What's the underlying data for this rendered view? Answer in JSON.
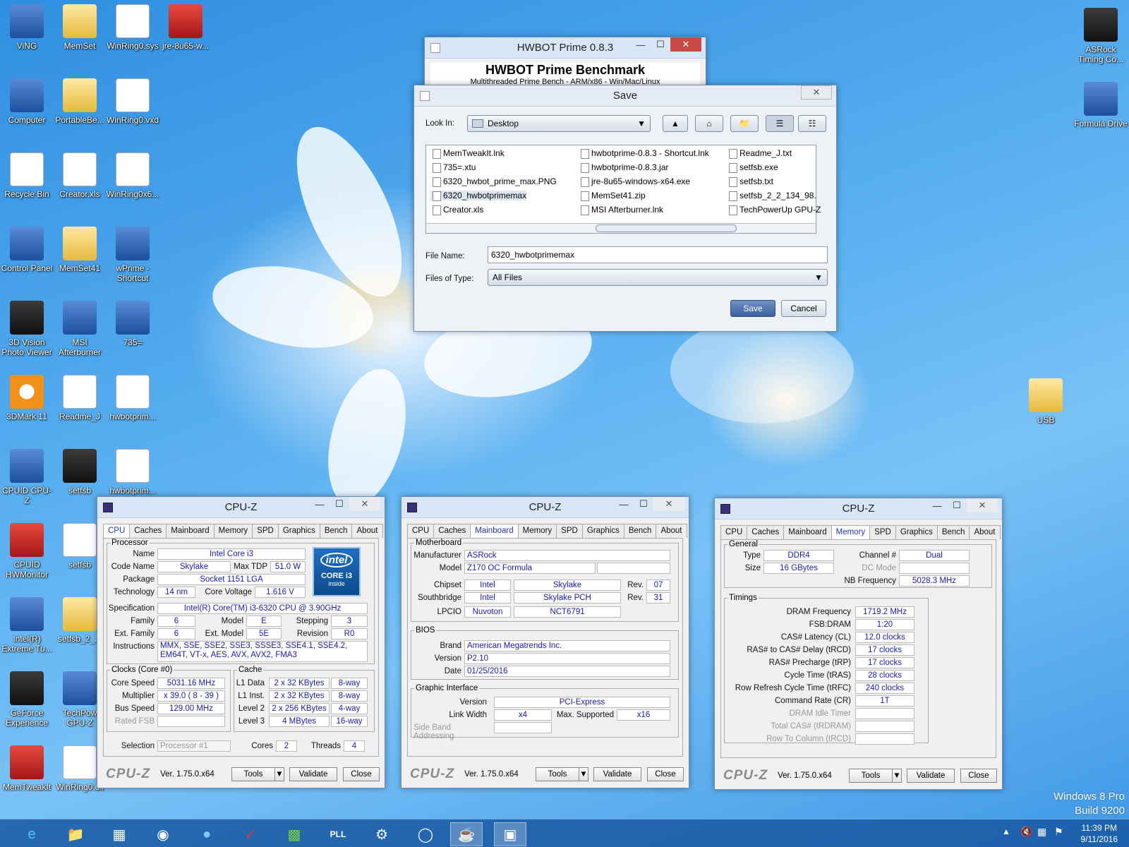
{
  "desktop_icons": [
    "ViNG",
    "MemSet",
    "WinRing0.sys",
    "jre-8u65-w...",
    "Computer",
    "PortableBe...",
    "WinRing0.vxd",
    "Recycle Bin",
    "Creator.xls",
    "WinRing0x6...",
    "Control Panel",
    "MemSet41",
    "wPrime - Shortcut",
    "3D Vision Photo Viewer",
    "MSI Afterburner",
    "735=",
    "3DMark 11",
    "Readme_J",
    "hwbotprim...",
    "CPUID CPU-Z",
    "setfsb",
    "hwbotprim...",
    "CPUID HWMonitor",
    "setfsb",
    "Intel(R) Extreme Tu...",
    "setfsb_2_...",
    "GeForce Experience",
    "TechPow GPU-Z",
    "MemTweakIt",
    "WinRing0.dll",
    "ASRock Timing Co...",
    "Formula Drive",
    "USB"
  ],
  "hwbot": {
    "title": "HWBOT Prime 0.8.3",
    "heading": "HWBOT Prime Benchmark",
    "sub": "Multithreaded Prime Bench - ARM/x86 - Win/Mac/Linux"
  },
  "save": {
    "title": "Save",
    "look_in_label": "Look In:",
    "look_in": "Desktop",
    "files": [
      [
        "MemTweakIt.lnk",
        "735=.xtu",
        "6320_hwbot_prime_max.PNG",
        "6320_hwbotprimemax",
        "Creator.xls"
      ],
      [
        "hwbotprime-0.8.3 - Shortcut.lnk",
        "hwbotprime-0.8.3.jar",
        "jre-8u65-windows-x64.exe",
        "MemSet41.zip",
        "MSI Afterburner.lnk"
      ],
      [
        "Readme_J.txt",
        "setfsb.exe",
        "setfsb.txt",
        "setfsb_2_2_134_98.",
        "TechPowerUp GPU-Z"
      ]
    ],
    "file_name_label": "File Name:",
    "file_name": "6320_hwbotprimemax",
    "type_label": "Files of Type:",
    "type": "All Files",
    "save_btn": "Save",
    "cancel_btn": "Cancel"
  },
  "cpuz_common": {
    "title": "CPU-Z",
    "tabs": [
      "CPU",
      "Caches",
      "Mainboard",
      "Memory",
      "SPD",
      "Graphics",
      "Bench",
      "About"
    ],
    "brand": "CPU-Z",
    "version": "Ver. 1.75.0.x64",
    "tools": "Tools",
    "validate": "Validate",
    "close": "Close"
  },
  "cpu": {
    "processor": "Processor",
    "name_l": "Name",
    "name": "Intel Core i3",
    "code_l": "Code Name",
    "code": "Skylake",
    "tdp_l": "Max TDP",
    "tdp": "51.0 W",
    "pkg_l": "Package",
    "pkg": "Socket 1151 LGA",
    "tech_l": "Technology",
    "tech": "14 nm",
    "cv_l": "Core Voltage",
    "cv": "1.616 V",
    "spec_l": "Specification",
    "spec": "Intel(R) Core(TM) i3-6320 CPU @ 3.90GHz",
    "fam_l": "Family",
    "fam": "6",
    "model_l": "Model",
    "model": "E",
    "step_l": "Stepping",
    "step": "3",
    "efam_l": "Ext. Family",
    "efam": "6",
    "emod_l": "Ext. Model",
    "emod": "5E",
    "rev_l": "Revision",
    "rev": "R0",
    "ins_l": "Instructions",
    "ins": "MMX, SSE, SSE2, SSE3, SSSE3, SSE4.1, SSE4.2, EM64T, VT-x, AES, AVX, AVX2, FMA3",
    "clocks": "Clocks (Core #0)",
    "cs_l": "Core Speed",
    "cs": "5031.16 MHz",
    "mul_l": "Multiplier",
    "mul": "x 39.0 ( 8 - 39 )",
    "bus_l": "Bus Speed",
    "bus": "129.00 MHz",
    "fsb_l": "Rated FSB",
    "cache": "Cache",
    "l1d_l": "L1 Data",
    "l1d": "2 x 32 KBytes",
    "l1d_w": "8-way",
    "l1i_l": "L1 Inst.",
    "l1i": "2 x 32 KBytes",
    "l1i_w": "8-way",
    "l2_l": "Level 2",
    "l2": "2 x 256 KBytes",
    "l2_w": "4-way",
    "l3_l": "Level 3",
    "l3": "4 MBytes",
    "l3_w": "16-way",
    "sel_l": "Selection",
    "sel": "Processor #1",
    "cores_l": "Cores",
    "cores": "2",
    "thr_l": "Threads",
    "thr": "4",
    "logo_top": "intel",
    "logo_mid": "CORE i3",
    "logo_bot": "inside"
  },
  "mb": {
    "mb": "Motherboard",
    "man_l": "Manufacturer",
    "man": "ASRock",
    "mod_l": "Model",
    "mod": "Z170 OC Formula",
    "chip_l": "Chipset",
    "chip1": "Intel",
    "chip2": "Skylake",
    "rev_l": "Rev.",
    "chip_rev": "07",
    "sb_l": "Southbridge",
    "sb1": "Intel",
    "sb2": "Skylake PCH",
    "sb_rev": "31",
    "lpc_l": "LPCIO",
    "lpc1": "Nuvoton",
    "lpc2": "NCT6791",
    "bios": "BIOS",
    "brand_l": "Brand",
    "brand": "American Megatrends Inc.",
    "ver_l": "Version",
    "ver": "P2.10",
    "date_l": "Date",
    "date": "01/25/2016",
    "gi": "Graphic Interface",
    "gver_l": "Version",
    "gver": "PCI-Express",
    "lw_l": "Link Width",
    "lw": "x4",
    "ms_l": "Max. Supported",
    "ms": "x16",
    "sba_l": "Side Band Addressing"
  },
  "mem": {
    "general": "General",
    "type_l": "Type",
    "type": "DDR4",
    "ch_l": "Channel #",
    "ch": "Dual",
    "size_l": "Size",
    "size": "16 GBytes",
    "dc_l": "DC Mode",
    "nb_l": "NB Frequency",
    "nb": "5028.3 MHz",
    "timings": "Timings",
    "rows": [
      [
        "DRAM Frequency",
        "1719.2 MHz"
      ],
      [
        "FSB:DRAM",
        "1:20"
      ],
      [
        "CAS# Latency (CL)",
        "12.0 clocks"
      ],
      [
        "RAS# to CAS# Delay (tRCD)",
        "17 clocks"
      ],
      [
        "RAS# Precharge (tRP)",
        "17 clocks"
      ],
      [
        "Cycle Time (tRAS)",
        "28 clocks"
      ],
      [
        "Row Refresh Cycle Time (tRFC)",
        "240 clocks"
      ],
      [
        "Command Rate (CR)",
        "1T"
      ],
      [
        "DRAM Idle Timer",
        ""
      ],
      [
        "Total CAS# (tRDRAM)",
        ""
      ],
      [
        "Row To Column (tRCD)",
        ""
      ]
    ]
  },
  "os": {
    "line1": "Windows 8 Pro",
    "line2": "Build 9200"
  },
  "clock": {
    "time": "11:39 PM",
    "date": "9/11/2016"
  }
}
